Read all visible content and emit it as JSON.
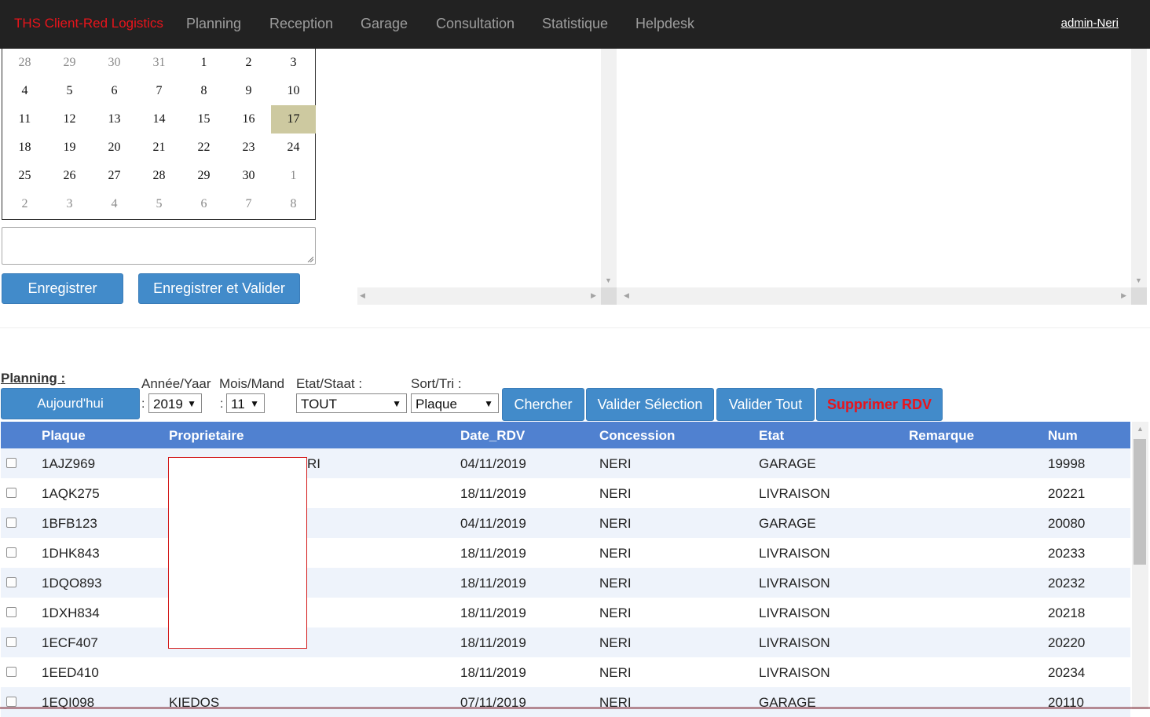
{
  "nav": {
    "brand": "THS Client-Red Logistics",
    "items": [
      "Planning",
      "Reception",
      "Garage",
      "Consultation",
      "Statistique",
      "Helpdesk"
    ],
    "user": "admin-Neri"
  },
  "calendar": {
    "weeks": [
      [
        {
          "d": "28",
          "o": true
        },
        {
          "d": "29",
          "o": true
        },
        {
          "d": "30",
          "o": true
        },
        {
          "d": "31",
          "o": true
        },
        {
          "d": "1"
        },
        {
          "d": "2"
        },
        {
          "d": "3"
        }
      ],
      [
        {
          "d": "4"
        },
        {
          "d": "5"
        },
        {
          "d": "6"
        },
        {
          "d": "7"
        },
        {
          "d": "8"
        },
        {
          "d": "9"
        },
        {
          "d": "10"
        }
      ],
      [
        {
          "d": "11"
        },
        {
          "d": "12"
        },
        {
          "d": "13"
        },
        {
          "d": "14"
        },
        {
          "d": "15"
        },
        {
          "d": "16"
        },
        {
          "d": "17",
          "s": true
        }
      ],
      [
        {
          "d": "18"
        },
        {
          "d": "19"
        },
        {
          "d": "20"
        },
        {
          "d": "21"
        },
        {
          "d": "22"
        },
        {
          "d": "23"
        },
        {
          "d": "24"
        }
      ],
      [
        {
          "d": "25"
        },
        {
          "d": "26"
        },
        {
          "d": "27"
        },
        {
          "d": "28"
        },
        {
          "d": "29"
        },
        {
          "d": "30"
        },
        {
          "d": "1",
          "o": true
        }
      ],
      [
        {
          "d": "2",
          "o": true
        },
        {
          "d": "3",
          "o": true
        },
        {
          "d": "4",
          "o": true
        },
        {
          "d": "5",
          "o": true
        },
        {
          "d": "6",
          "o": true
        },
        {
          "d": "7",
          "o": true
        },
        {
          "d": "8",
          "o": true
        }
      ]
    ]
  },
  "form": {
    "note_value": "",
    "save_label": "Enregistrer",
    "save_validate_label": "Enregistrer et Valider"
  },
  "planning": {
    "label": "Planning :",
    "today_label": "Aujourd'hui",
    "year_label": "Année/Yaar",
    "year_value": "2019",
    "month_label": "Mois/Mand",
    "month_value": "11",
    "state_label": "Etat/Staat :",
    "state_value": "TOUT",
    "sort_label": "Sort/Tri :",
    "sort_value": "Plaque",
    "colon": ":",
    "search_label": "Chercher",
    "validate_selection_label": "Valider Sélection",
    "validate_all_label": "Valider Tout",
    "delete_label": "Supprimer RDV",
    "delete_color": "#e8141b"
  },
  "table": {
    "headers": [
      "Plaque",
      "Proprietaire",
      "Date_RDV",
      "Concession",
      "Etat",
      "Remarque",
      "Num"
    ],
    "rows": [
      {
        "plaque": "1AJZ969",
        "proprietaire": "RI",
        "date": "04/11/2019",
        "concession": "NERI",
        "etat": "GARAGE",
        "remarque": "",
        "num": "19998"
      },
      {
        "plaque": "1AQK275",
        "proprietaire": "",
        "date": "18/11/2019",
        "concession": "NERI",
        "etat": "LIVRAISON",
        "remarque": "",
        "num": "20221"
      },
      {
        "plaque": "1BFB123",
        "proprietaire": "",
        "date": "04/11/2019",
        "concession": "NERI",
        "etat": "GARAGE",
        "remarque": "",
        "num": "20080"
      },
      {
        "plaque": "1DHK843",
        "proprietaire": "",
        "date": "18/11/2019",
        "concession": "NERI",
        "etat": "LIVRAISON",
        "remarque": "",
        "num": "20233"
      },
      {
        "plaque": "1DQO893",
        "proprietaire": "",
        "date": "18/11/2019",
        "concession": "NERI",
        "etat": "LIVRAISON",
        "remarque": "",
        "num": "20232"
      },
      {
        "plaque": "1DXH834",
        "proprietaire": "",
        "date": "18/11/2019",
        "concession": "NERI",
        "etat": "LIVRAISON",
        "remarque": "",
        "num": "20218"
      },
      {
        "plaque": "1ECF407",
        "proprietaire": "",
        "date": "18/11/2019",
        "concession": "NERI",
        "etat": "LIVRAISON",
        "remarque": "",
        "num": "20220"
      },
      {
        "plaque": "1EED410",
        "proprietaire": "",
        "date": "18/11/2019",
        "concession": "NERI",
        "etat": "LIVRAISON",
        "remarque": "",
        "num": "20234"
      },
      {
        "plaque": "1EQI098",
        "proprietaire": "KIEDOS",
        "date": "07/11/2019",
        "concession": "NERI",
        "etat": "GARAGE",
        "remarque": "",
        "num": "20110"
      }
    ]
  }
}
